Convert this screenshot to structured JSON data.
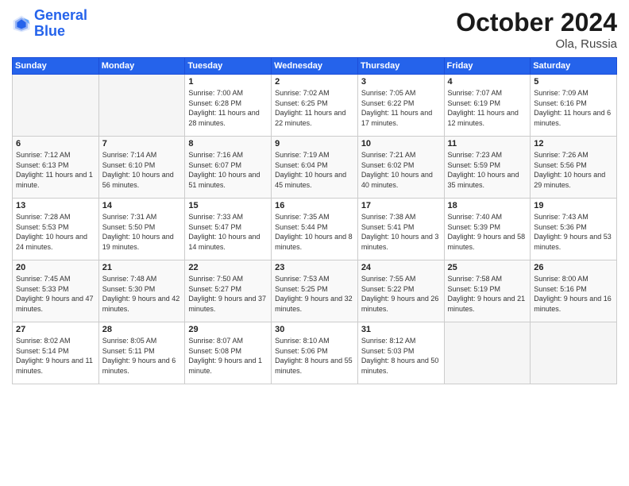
{
  "logo": {
    "line1": "General",
    "line2": "Blue"
  },
  "title": "October 2024",
  "location": "Ola, Russia",
  "weekdays": [
    "Sunday",
    "Monday",
    "Tuesday",
    "Wednesday",
    "Thursday",
    "Friday",
    "Saturday"
  ],
  "weeks": [
    [
      {
        "day": "",
        "empty": true
      },
      {
        "day": "",
        "empty": true
      },
      {
        "day": "1",
        "sunrise": "Sunrise: 7:00 AM",
        "sunset": "Sunset: 6:28 PM",
        "daylight": "Daylight: 11 hours and 28 minutes."
      },
      {
        "day": "2",
        "sunrise": "Sunrise: 7:02 AM",
        "sunset": "Sunset: 6:25 PM",
        "daylight": "Daylight: 11 hours and 22 minutes."
      },
      {
        "day": "3",
        "sunrise": "Sunrise: 7:05 AM",
        "sunset": "Sunset: 6:22 PM",
        "daylight": "Daylight: 11 hours and 17 minutes."
      },
      {
        "day": "4",
        "sunrise": "Sunrise: 7:07 AM",
        "sunset": "Sunset: 6:19 PM",
        "daylight": "Daylight: 11 hours and 12 minutes."
      },
      {
        "day": "5",
        "sunrise": "Sunrise: 7:09 AM",
        "sunset": "Sunset: 6:16 PM",
        "daylight": "Daylight: 11 hours and 6 minutes."
      }
    ],
    [
      {
        "day": "6",
        "sunrise": "Sunrise: 7:12 AM",
        "sunset": "Sunset: 6:13 PM",
        "daylight": "Daylight: 11 hours and 1 minute."
      },
      {
        "day": "7",
        "sunrise": "Sunrise: 7:14 AM",
        "sunset": "Sunset: 6:10 PM",
        "daylight": "Daylight: 10 hours and 56 minutes."
      },
      {
        "day": "8",
        "sunrise": "Sunrise: 7:16 AM",
        "sunset": "Sunset: 6:07 PM",
        "daylight": "Daylight: 10 hours and 51 minutes."
      },
      {
        "day": "9",
        "sunrise": "Sunrise: 7:19 AM",
        "sunset": "Sunset: 6:04 PM",
        "daylight": "Daylight: 10 hours and 45 minutes."
      },
      {
        "day": "10",
        "sunrise": "Sunrise: 7:21 AM",
        "sunset": "Sunset: 6:02 PM",
        "daylight": "Daylight: 10 hours and 40 minutes."
      },
      {
        "day": "11",
        "sunrise": "Sunrise: 7:23 AM",
        "sunset": "Sunset: 5:59 PM",
        "daylight": "Daylight: 10 hours and 35 minutes."
      },
      {
        "day": "12",
        "sunrise": "Sunrise: 7:26 AM",
        "sunset": "Sunset: 5:56 PM",
        "daylight": "Daylight: 10 hours and 29 minutes."
      }
    ],
    [
      {
        "day": "13",
        "sunrise": "Sunrise: 7:28 AM",
        "sunset": "Sunset: 5:53 PM",
        "daylight": "Daylight: 10 hours and 24 minutes."
      },
      {
        "day": "14",
        "sunrise": "Sunrise: 7:31 AM",
        "sunset": "Sunset: 5:50 PM",
        "daylight": "Daylight: 10 hours and 19 minutes."
      },
      {
        "day": "15",
        "sunrise": "Sunrise: 7:33 AM",
        "sunset": "Sunset: 5:47 PM",
        "daylight": "Daylight: 10 hours and 14 minutes."
      },
      {
        "day": "16",
        "sunrise": "Sunrise: 7:35 AM",
        "sunset": "Sunset: 5:44 PM",
        "daylight": "Daylight: 10 hours and 8 minutes."
      },
      {
        "day": "17",
        "sunrise": "Sunrise: 7:38 AM",
        "sunset": "Sunset: 5:41 PM",
        "daylight": "Daylight: 10 hours and 3 minutes."
      },
      {
        "day": "18",
        "sunrise": "Sunrise: 7:40 AM",
        "sunset": "Sunset: 5:39 PM",
        "daylight": "Daylight: 9 hours and 58 minutes."
      },
      {
        "day": "19",
        "sunrise": "Sunrise: 7:43 AM",
        "sunset": "Sunset: 5:36 PM",
        "daylight": "Daylight: 9 hours and 53 minutes."
      }
    ],
    [
      {
        "day": "20",
        "sunrise": "Sunrise: 7:45 AM",
        "sunset": "Sunset: 5:33 PM",
        "daylight": "Daylight: 9 hours and 47 minutes."
      },
      {
        "day": "21",
        "sunrise": "Sunrise: 7:48 AM",
        "sunset": "Sunset: 5:30 PM",
        "daylight": "Daylight: 9 hours and 42 minutes."
      },
      {
        "day": "22",
        "sunrise": "Sunrise: 7:50 AM",
        "sunset": "Sunset: 5:27 PM",
        "daylight": "Daylight: 9 hours and 37 minutes."
      },
      {
        "day": "23",
        "sunrise": "Sunrise: 7:53 AM",
        "sunset": "Sunset: 5:25 PM",
        "daylight": "Daylight: 9 hours and 32 minutes."
      },
      {
        "day": "24",
        "sunrise": "Sunrise: 7:55 AM",
        "sunset": "Sunset: 5:22 PM",
        "daylight": "Daylight: 9 hours and 26 minutes."
      },
      {
        "day": "25",
        "sunrise": "Sunrise: 7:58 AM",
        "sunset": "Sunset: 5:19 PM",
        "daylight": "Daylight: 9 hours and 21 minutes."
      },
      {
        "day": "26",
        "sunrise": "Sunrise: 8:00 AM",
        "sunset": "Sunset: 5:16 PM",
        "daylight": "Daylight: 9 hours and 16 minutes."
      }
    ],
    [
      {
        "day": "27",
        "sunrise": "Sunrise: 8:02 AM",
        "sunset": "Sunset: 5:14 PM",
        "daylight": "Daylight: 9 hours and 11 minutes."
      },
      {
        "day": "28",
        "sunrise": "Sunrise: 8:05 AM",
        "sunset": "Sunset: 5:11 PM",
        "daylight": "Daylight: 9 hours and 6 minutes."
      },
      {
        "day": "29",
        "sunrise": "Sunrise: 8:07 AM",
        "sunset": "Sunset: 5:08 PM",
        "daylight": "Daylight: 9 hours and 1 minute."
      },
      {
        "day": "30",
        "sunrise": "Sunrise: 8:10 AM",
        "sunset": "Sunset: 5:06 PM",
        "daylight": "Daylight: 8 hours and 55 minutes."
      },
      {
        "day": "31",
        "sunrise": "Sunrise: 8:12 AM",
        "sunset": "Sunset: 5:03 PM",
        "daylight": "Daylight: 8 hours and 50 minutes."
      },
      {
        "day": "",
        "empty": true
      },
      {
        "day": "",
        "empty": true
      }
    ]
  ]
}
